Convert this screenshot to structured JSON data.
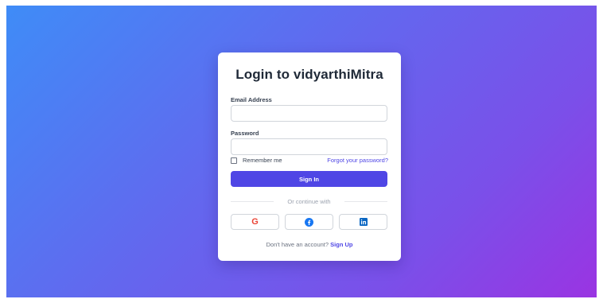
{
  "login": {
    "title": "Login to vidyarthiMitra",
    "email_label": "Email Address",
    "email_value": "",
    "password_label": "Password",
    "password_value": "",
    "remember_label": "Remember me",
    "remember_checked": false,
    "forgot_label": "Forgot your password?",
    "signin_label": "Sign In",
    "divider_text": "Or continue with",
    "social": [
      {
        "name": "google",
        "icon": "google-icon"
      },
      {
        "name": "facebook",
        "icon": "facebook-icon"
      },
      {
        "name": "linkedin",
        "icon": "linkedin-icon"
      }
    ],
    "signup_prompt": "Don't have an account?",
    "signup_label": "Sign Up"
  },
  "colors": {
    "background_gradient": [
      "#3f8cf7",
      "#6466ee",
      "#9a34e2"
    ],
    "accent": "#4f46e5",
    "google": "#ea4335",
    "facebook": "#1877f2",
    "linkedin": "#0a66c2"
  }
}
